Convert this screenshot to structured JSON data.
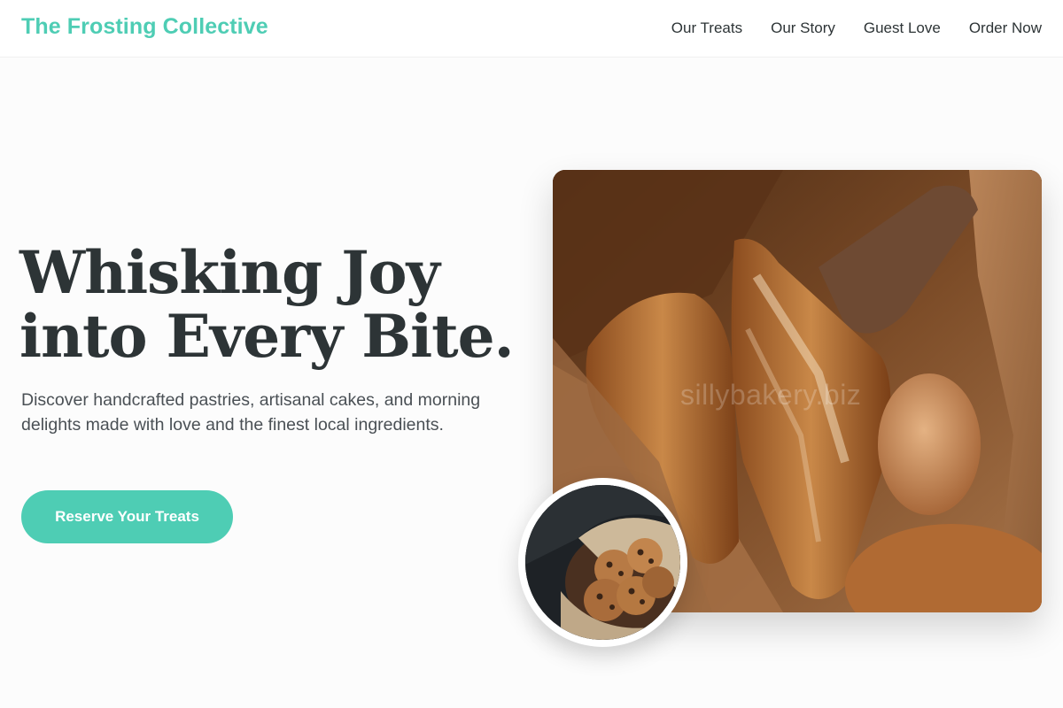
{
  "header": {
    "brand": "The Frosting Collective",
    "nav": [
      "Our Treats",
      "Our Story",
      "Guest Love",
      "Order Now"
    ]
  },
  "hero": {
    "title_line1": "Whisking Joy",
    "title_line2": "into Every Bite.",
    "subtitle": "Discover handcrafted pastries, artisanal cakes, and morning delights made with love and the finest local ingredients.",
    "cta_label": "Reserve Your Treats",
    "main_image_watermark": "sillybakery.biz"
  },
  "colors": {
    "accent": "#4ecdb4",
    "heading": "#2d3436",
    "body_text": "#4a5055",
    "background": "#fcfcfc"
  }
}
